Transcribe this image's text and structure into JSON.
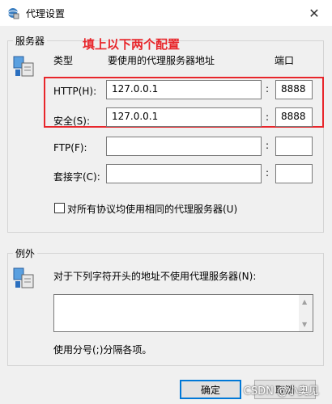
{
  "window": {
    "title": "代理设置",
    "close_glyph": "✕"
  },
  "servers": {
    "group_label": "服务器",
    "annotation": "填上以下两个配置",
    "col_type": "类型",
    "col_address": "要使用的代理服务器地址",
    "col_port": "端口",
    "rows": [
      {
        "label": "HTTP(H):",
        "address": "127.0.0.1",
        "port": "8888"
      },
      {
        "label": "安全(S):",
        "address": "127.0.0.1",
        "port": "8888"
      },
      {
        "label": "FTP(F):",
        "address": "",
        "port": ""
      },
      {
        "label": "套接字(C):",
        "address": "",
        "port": ""
      }
    ],
    "same_proxy_label": "对所有协议均使用相同的代理服务器(U)",
    "same_proxy_checked": false
  },
  "exceptions": {
    "group_label": "例外",
    "description": "对于下列字符开头的地址不使用代理服务器(N):",
    "value": "",
    "hint": "使用分号(;)分隔各项。"
  },
  "buttons": {
    "ok": "确定",
    "cancel": "取消"
  },
  "watermark": "CSDN @小奥见",
  "colors": {
    "annotation": "#e8262b",
    "default_button_border": "#0078d7"
  },
  "icons": [
    "app-settings-icon",
    "close-icon",
    "proxy-server-icon",
    "exceptions-server-icon",
    "scroll-up-icon",
    "scroll-down-icon"
  ]
}
